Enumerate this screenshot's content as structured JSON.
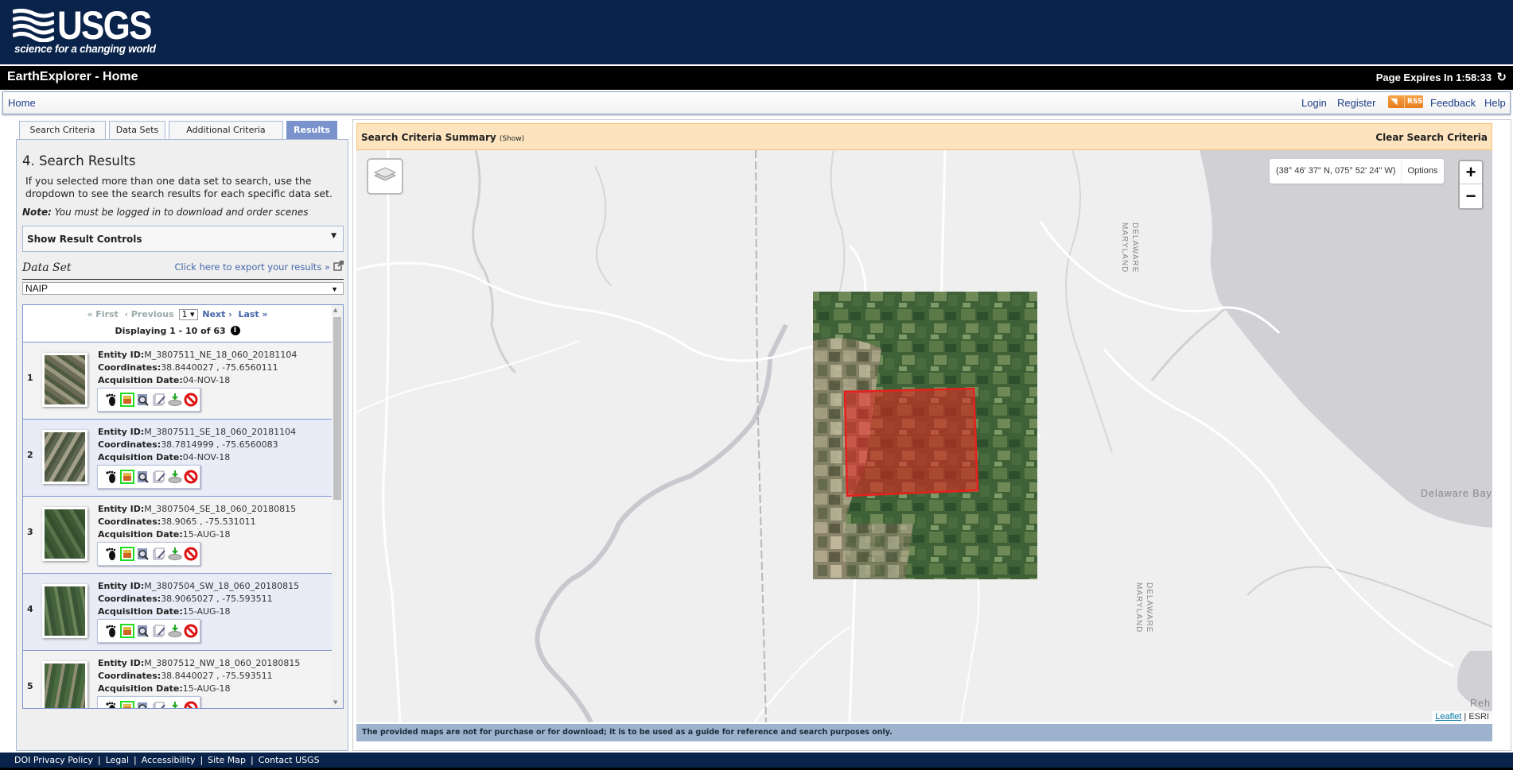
{
  "header": {
    "logo_text": "USGS",
    "tagline": "science for a changing world",
    "app_title": "EarthExplorer - Home",
    "page_expires": "Page Expires In 1:58:33"
  },
  "nav": {
    "home": "Home",
    "login": "Login",
    "register": "Register",
    "rss": "RSS",
    "feedback": "Feedback",
    "help": "Help"
  },
  "tabs": [
    {
      "label": "Search Criteria",
      "active": false
    },
    {
      "label": "Data Sets",
      "active": false
    },
    {
      "label": "Additional Criteria",
      "active": false
    },
    {
      "label": "Results",
      "active": true
    }
  ],
  "panel": {
    "heading": "4. Search Results",
    "intro": "If you selected more than one data set to search, use the dropdown to see the search results for each specific data set.",
    "note_label": "Note:",
    "note_text": " You must be logged in to download and order scenes",
    "result_controls": "Show Result Controls",
    "dataset_label": "Data Set",
    "export_link": "Click here to export your results »",
    "dataset_selected": "NAIP"
  },
  "pager": {
    "first": "« First",
    "previous": "‹ Previous",
    "page": "1",
    "next": "Next ›",
    "last": "Last »",
    "displaying": "Displaying 1 - 10 of 63"
  },
  "result_labels": {
    "entity": "Entity ID:",
    "coords": "Coordinates:",
    "date": "Acquisition Date:"
  },
  "results": [
    {
      "num": "1",
      "entity_id": "M_3807511_NE_18_060_20181104",
      "coordinates": "38.8440027 , -75.6560111",
      "date": "04-NOV-18"
    },
    {
      "num": "2",
      "entity_id": "M_3807511_SE_18_060_20181104",
      "coordinates": "38.7814999 , -75.6560083",
      "date": "04-NOV-18"
    },
    {
      "num": "3",
      "entity_id": "M_3807504_SE_18_060_20180815",
      "coordinates": "38.9065 , -75.531011",
      "date": "15-AUG-18"
    },
    {
      "num": "4",
      "entity_id": "M_3807504_SW_18_060_20180815",
      "coordinates": "38.9065027 , -75.593511",
      "date": "15-AUG-18"
    },
    {
      "num": "5",
      "entity_id": "M_3807512_NW_18_060_20180815",
      "coordinates": "38.8440027 , -75.593511",
      "date": "15-AUG-18"
    }
  ],
  "result_tools": [
    "footprint-icon",
    "browse-overlay-icon",
    "show-browse-icon",
    "metadata-icon",
    "download-icon",
    "exclude-icon"
  ],
  "map": {
    "criteria_title": "Search Criteria Summary",
    "criteria_show": "(Show)",
    "clear_criteria": "Clear Search Criteria",
    "coordinates": "(38° 46' 37\" N, 075° 52' 24\" W)",
    "options": "Options",
    "zoom_in": "+",
    "zoom_out": "−",
    "label_bay": "Delaware Bay",
    "label_partial": "Reh",
    "state_east": "DELAWARE",
    "state_west": "MARYLAND",
    "attribution_leaflet": "Leaflet",
    "attribution_sep": " | ",
    "attribution_esri": "ESRI",
    "disclaimer": "The provided maps are not for purchase or for download; it is to be used as a guide for reference and search purposes only.",
    "colors": {
      "footprint": "#e8201e",
      "water": "#d0d0d5",
      "land": "#efefef"
    }
  },
  "footer": {
    "links": [
      "DOI Privacy Policy",
      "Legal",
      "Accessibility",
      "Site Map",
      "Contact USGS"
    ]
  }
}
